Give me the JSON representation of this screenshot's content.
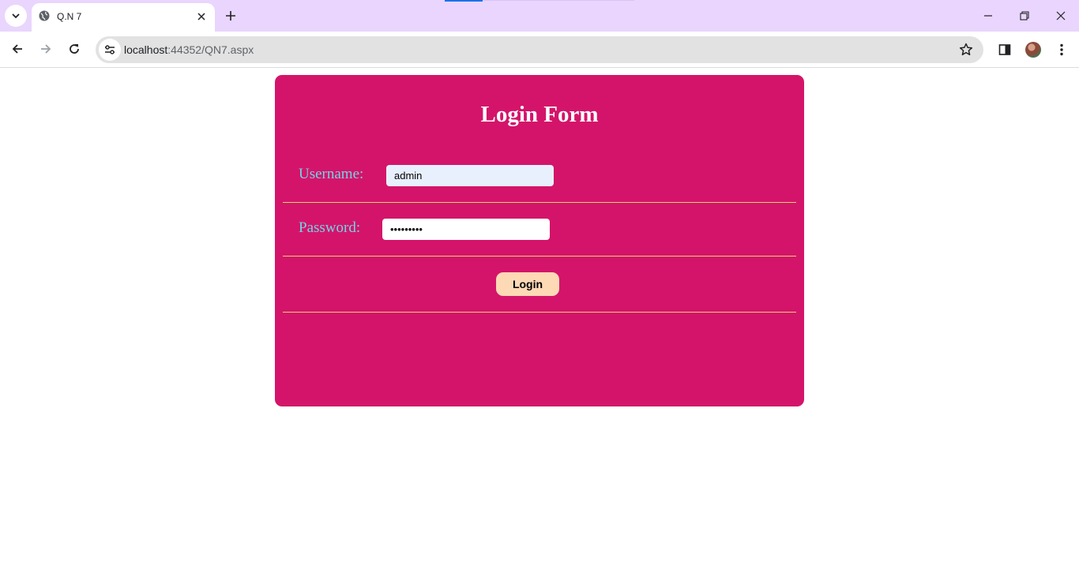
{
  "browser": {
    "tab_title": "Q.N 7",
    "url_host": "localhost",
    "url_path": ":44352/QN7.aspx",
    "icons": {
      "tab_list": "chevron-down-icon",
      "favicon": "globe-icon",
      "tab_close": "close-icon",
      "new_tab": "plus-icon",
      "back": "back-arrow-icon",
      "forward": "forward-arrow-icon",
      "reload": "reload-icon",
      "site_info": "tune-icon",
      "bookmark": "star-icon",
      "side_panel": "side-panel-icon",
      "profile": "avatar",
      "menu": "kebab-menu-icon",
      "minimize": "minimize-icon",
      "restore": "restore-icon",
      "close_window": "close-icon"
    },
    "colors": {
      "tabbar": "#e9d5fd",
      "omnibox": "#e2e2e2"
    }
  },
  "form": {
    "title": "Login Form",
    "username_label": "Username:",
    "username_value": "admin",
    "password_label": "Password:",
    "password_value": "•••••••••",
    "login_label": "Login",
    "colors": {
      "card_bg": "#d4146a",
      "label": "#6fd6e8",
      "divider": "#e3d36b",
      "autofill_bg": "#e8f0fe",
      "button_bg": "#fdd9b5"
    }
  }
}
